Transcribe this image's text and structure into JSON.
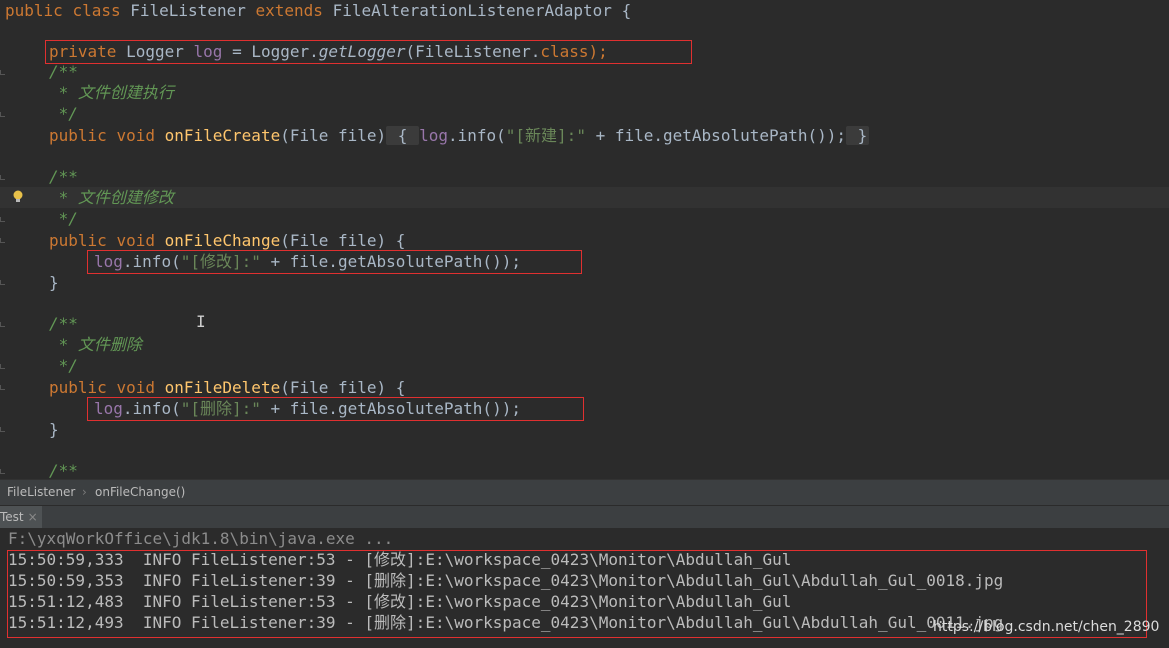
{
  "editor": {
    "class_decl": {
      "kw1": "public",
      "kw2": "class",
      "name": "FileListener",
      "kw3": "extends",
      "parent": "FileAlterationListenerAdaptor",
      "brace": "{"
    },
    "logger_decl": {
      "kw": "private",
      "type": "Logger",
      "field": "log",
      "eq": "=",
      "call_obj": "Logger.",
      "call_mth": "getLogger",
      "arg_open": "(FileListener.",
      "arg_kw": "class",
      "arg_close": ");"
    },
    "comments": {
      "open": "/**",
      "create": " * 文件创建执行",
      "change": " * 文件创建修改",
      "delete": " * 文件删除",
      "close": " */"
    },
    "on_create": {
      "kw1": "public",
      "kw2": "void",
      "name": "onFileCreate",
      "params": "(File file)",
      "fold_open": " { ",
      "log": "log",
      "body1": ".info(",
      "str": "\"[新建]:\"",
      "body2": " + file.getAbsolutePath());",
      "fold_close": " }"
    },
    "on_change": {
      "kw1": "public",
      "kw2": "void",
      "name": "onFileChange",
      "params": "(File file) {",
      "log": "log",
      "body1": ".info(",
      "str": "\"[修改]:\"",
      "body2": " + file.getAbsolutePath());",
      "close": "}"
    },
    "on_delete": {
      "kw1": "public",
      "kw2": "void",
      "name": "onFileDelete",
      "params": "(File file) {",
      "log": "log",
      "body1": ".info(",
      "str": "\"[删除]:\"",
      "body2": " + file.getAbsolutePath());",
      "close": "}"
    }
  },
  "breadcrumb": {
    "class": "FileListener",
    "sep": "›",
    "method": "onFileChange()"
  },
  "run_tab": {
    "label": "Test",
    "close": "×"
  },
  "console": {
    "command": "F:\\yxqWorkOffice\\jdk1.8\\bin\\java.exe ...",
    "lines": [
      "15:50:59,333  INFO FileListener:53 - [修改]:E:\\workspace_0423\\Monitor\\Abdullah_Gul",
      "15:50:59,353  INFO FileListener:39 - [删除]:E:\\workspace_0423\\Monitor\\Abdullah_Gul\\Abdullah_Gul_0018.jpg",
      "15:51:12,483  INFO FileListener:53 - [修改]:E:\\workspace_0423\\Monitor\\Abdullah_Gul",
      "15:51:12,493  INFO FileListener:39 - [删除]:E:\\workspace_0423\\Monitor\\Abdullah_Gul\\Abdullah_Gul_0011.jpg"
    ]
  },
  "watermark": "https://blog.csdn.net/chen_2890"
}
